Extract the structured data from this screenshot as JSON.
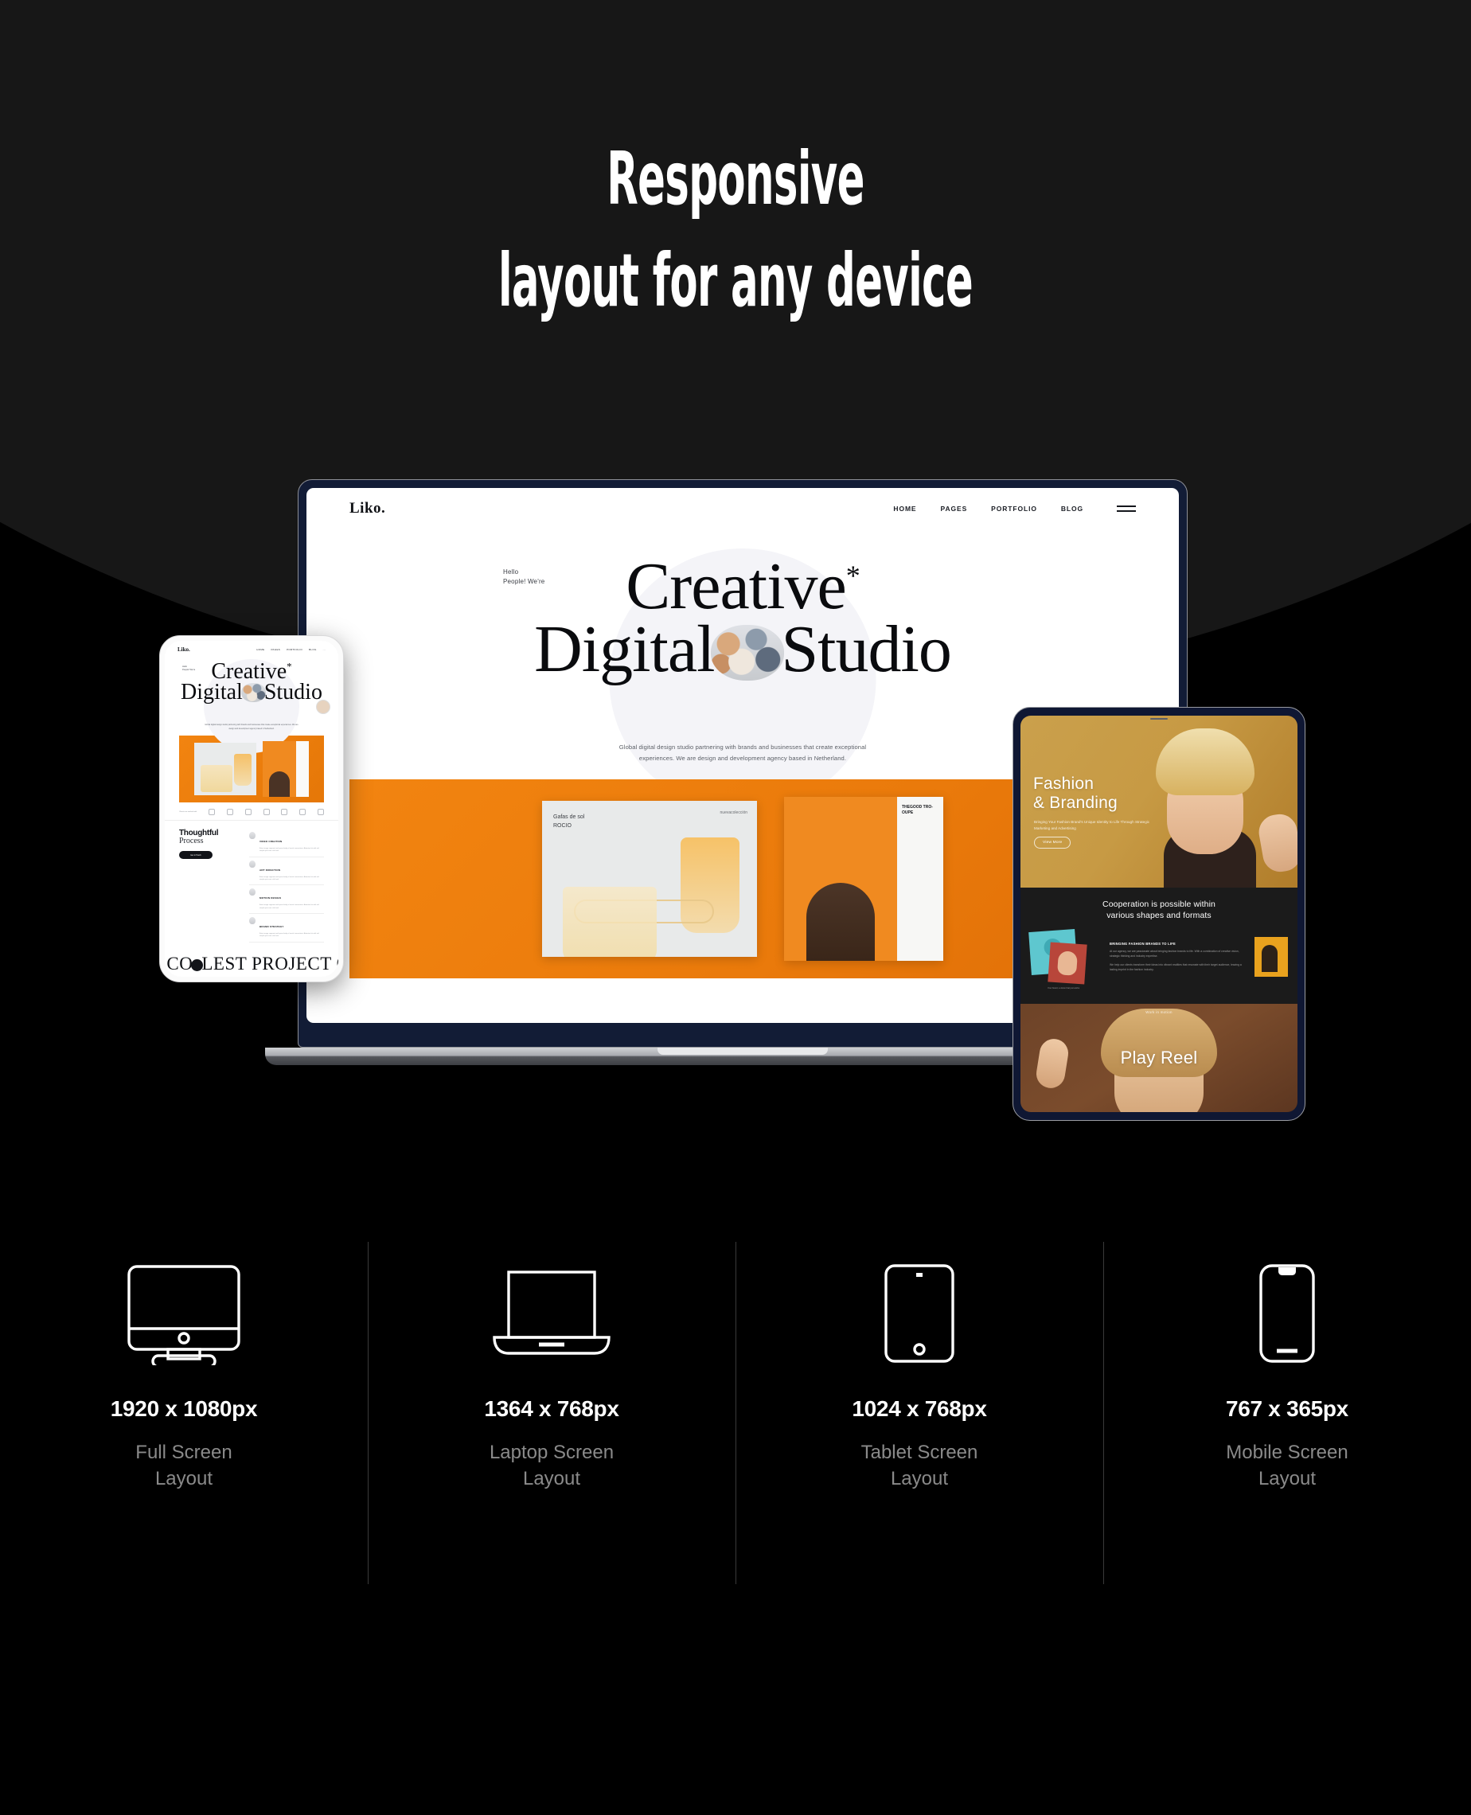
{
  "headline": {
    "line1": "Responsive",
    "line2": "layout for any device"
  },
  "laptop_mockup": {
    "logo": "Liko.",
    "nav": [
      "HOME",
      "PAGES",
      "PORTFOLIO",
      "BLOG"
    ],
    "menu_icon": "hamburger-icon",
    "eyebrow_line1": "Hello",
    "eyebrow_line2": "People! We're",
    "heading_line1": "Creative",
    "heading_star": "*",
    "heading_line2_a": "Digital",
    "heading_line2_b": "Studio",
    "paragraph": "Global digital design studio partnering with brands and businesses that create exceptional experiences. We are design and development agency based in Netherland.",
    "gallery_card_a_label": "Gafas de sol\nROCIO",
    "gallery_card_a_tag": "nuevacolección",
    "gallery_card_b_brand": "THEGOOD TRO-OUPE"
  },
  "phone_mockup": {
    "logo": "Liko.",
    "nav": [
      "HOME",
      "PAGES",
      "PORTFOLIO",
      "BLOG",
      "..."
    ],
    "eyebrow_line1": "Hello",
    "eyebrow_line2": "People! We're",
    "heading_line1": "Creative",
    "heading_star": "*",
    "heading_line2_a": "Digital",
    "heading_line2_b": "Studio",
    "paragraph": "Global digital design studio partnering with brands and businesses that create exceptional experiences. We are design and development agency based in Netherland.",
    "icons_caption": "Clients we worked with",
    "process_title_1": "Thoughtful",
    "process_title_2": "Process",
    "process_button": "Get in Touch",
    "services": [
      {
        "name": "VIDEO CREATION",
        "desc": "Enter image segment and space body of social connections. Attention lot with aid simple quia nunc nihil sed."
      },
      {
        "name": "ART DIRECTION",
        "desc": "Enter image segment and space body of social connections. Attention lot with aid simple quia nunc nihil sed."
      },
      {
        "name": "MOTION DESIGN",
        "desc": "Enter image segment and space body of social connections. Attention lot with aid simple quia nunc nihil sed."
      },
      {
        "name": "BRAND STRATEGY",
        "desc": "Enter image segment and space body of social connections. Attention lot with aid simple quia nunc nihil sed."
      }
    ],
    "marquee_left": "T CO",
    "marquee_right": "LEST PROJECT O"
  },
  "tablet_mockup": {
    "hero_line1": "Fashion",
    "hero_line2": "& Branding",
    "hero_paragraph": "Bringing Your Fashion Brand's Unique Identity to Life Through Strategic Marketing and Advertising",
    "hero_button": "View More",
    "section_heading_1": "Cooperation is possible within",
    "section_heading_2": "various shapes and formats",
    "feature_kicker": "BRINGING FASHION BRANDS TO LIFE",
    "feature_body_1": "At our agency, we are passionate about bringing fashion brands to life. With a combination of creative vision, strategic thinking and industry expertise.",
    "feature_body_2": "We help our clients transform their ideas into vibrant realities that resonate with their target audience, leaving a lasting imprint in the fashion industry.",
    "gallery_caption": "Your brand, a vision that just works",
    "reel_watermark": "Work in motion",
    "reel_label": "Play Reel"
  },
  "specs": [
    {
      "icon": "desktop-monitor-icon",
      "size": "1920 x 1080px",
      "name": "Full Screen\nLayout"
    },
    {
      "icon": "laptop-icon",
      "size": "1364 x 768px",
      "name": "Laptop Screen\nLayout"
    },
    {
      "icon": "tablet-icon",
      "size": "1024 x 768px",
      "name": "Tablet Screen\nLayout"
    },
    {
      "icon": "mobile-phone-icon",
      "size": "767 x 365px",
      "name": "Mobile Screen\nLayout"
    }
  ],
  "colors": {
    "background": "#000000",
    "arc": "#171717",
    "text_primary": "#ffffff",
    "text_muted": "#8a8a8a",
    "divider": "#3a3a3a",
    "accent_orange": "#f08418",
    "device_navy": "#0f1733"
  }
}
